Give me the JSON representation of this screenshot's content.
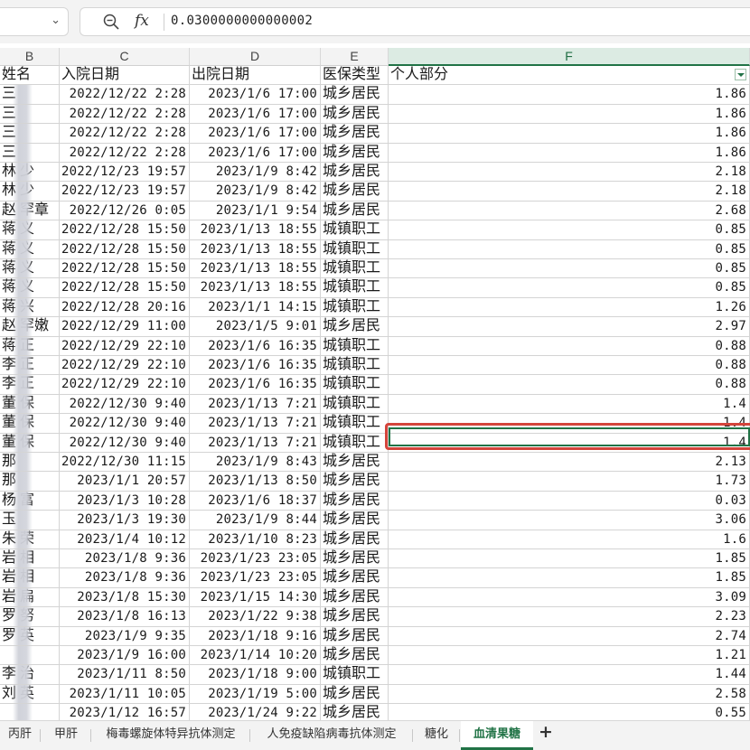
{
  "formula_bar": {
    "name_box_value": "",
    "formula_value": "0.0300000000000002"
  },
  "columns": [
    "B",
    "C",
    "D",
    "E",
    "F"
  ],
  "header_row": [
    "姓名",
    "入院日期",
    "出院日期",
    "医保类型",
    "个人部分"
  ],
  "rows": [
    [
      "三",
      "2022/12/22 2:28",
      "2023/1/6 17:00",
      "城乡居民",
      "1.86"
    ],
    [
      "三",
      "2022/12/22 2:28",
      "2023/1/6 17:00",
      "城乡居民",
      "1.86"
    ],
    [
      "三",
      "2022/12/22 2:28",
      "2023/1/6 17:00",
      "城乡居民",
      "1.86"
    ],
    [
      "三",
      "2022/12/22 2:28",
      "2023/1/6 17:00",
      "城乡居民",
      "1.86"
    ],
    [
      "林 少",
      "2022/12/23 19:57",
      "2023/1/9 8:42",
      "城乡居民",
      "2.18"
    ],
    [
      "林 少",
      "2022/12/23 19:57",
      "2023/1/9 8:42",
      "城乡居民",
      "2.18"
    ],
    [
      "赵 罕章",
      "2022/12/26 0:05",
      "2023/1/1 9:54",
      "城乡居民",
      "2.68"
    ],
    [
      "蒋 义",
      "2022/12/28 15:50",
      "2023/1/13 18:55",
      "城镇职工",
      "0.85"
    ],
    [
      "蒋 义",
      "2022/12/28 15:50",
      "2023/1/13 18:55",
      "城镇职工",
      "0.85"
    ],
    [
      "蒋 义",
      "2022/12/28 15:50",
      "2023/1/13 18:55",
      "城镇职工",
      "0.85"
    ],
    [
      "蒋 义",
      "2022/12/28 15:50",
      "2023/1/13 18:55",
      "城镇职工",
      "0.85"
    ],
    [
      "蒋 兴",
      "2022/12/28 20:16",
      "2023/1/1 14:15",
      "城镇职工",
      "1.26"
    ],
    [
      "赵 罕嫩",
      "2022/12/29 11:00",
      "2023/1/5 9:01",
      "城乡居民",
      "2.97"
    ],
    [
      "蒋 正",
      "2022/12/29 22:10",
      "2023/1/6 16:35",
      "城镇职工",
      "0.88"
    ],
    [
      "李 正",
      "2022/12/29 22:10",
      "2023/1/6 16:35",
      "城镇职工",
      "0.88"
    ],
    [
      "李 正",
      "2022/12/29 22:10",
      "2023/1/6 16:35",
      "城镇职工",
      "0.88"
    ],
    [
      "董 保",
      "2022/12/30 9:40",
      "2023/1/13 7:21",
      "城镇职工",
      "1.4"
    ],
    [
      "董 保",
      "2022/12/30 9:40",
      "2023/1/13 7:21",
      "城镇职工",
      "1.4"
    ],
    [
      "董 保",
      "2022/12/30 9:40",
      "2023/1/13 7:21",
      "城镇职工",
      "1.4"
    ],
    [
      "那",
      "2022/12/30 11:15",
      "2023/1/9 8:43",
      "城乡居民",
      "2.13"
    ],
    [
      "那",
      "2023/1/1 20:57",
      "2023/1/13 8:50",
      "城乡居民",
      "1.73"
    ],
    [
      "杨 富",
      "2023/1/3 10:28",
      "2023/1/6 18:37",
      "城乡居民",
      "0.03"
    ],
    [
      "玉",
      "2023/1/3 19:30",
      "2023/1/9 8:44",
      "城乡居民",
      "3.06"
    ],
    [
      "朱 荣",
      "2023/1/4 10:12",
      "2023/1/10 8:23",
      "城乡居民",
      "1.6"
    ],
    [
      "岩 相",
      "2023/1/8 9:36",
      "2023/1/23 23:05",
      "城乡居民",
      "1.85"
    ],
    [
      "岩 相",
      "2023/1/8 9:36",
      "2023/1/23 23:05",
      "城乡居民",
      "1.85"
    ],
    [
      "岩 扁",
      "2023/1/8 15:30",
      "2023/1/15 14:30",
      "城乡居民",
      "3.09"
    ],
    [
      "罗 努",
      "2023/1/8 16:13",
      "2023/1/22 9:38",
      "城乡居民",
      "2.23"
    ],
    [
      "罗 英",
      "2023/1/9 9:35",
      "2023/1/18 9:16",
      "城乡居民",
      "2.74"
    ],
    [
      "",
      "2023/1/9 16:00",
      "2023/1/14 10:20",
      "城乡居民",
      "1.21"
    ],
    [
      "李 治",
      "2023/1/11 8:50",
      "2023/1/18 9:00",
      "城镇职工",
      "1.44"
    ],
    [
      "刘 英",
      "2023/1/11 10:05",
      "2023/1/19 5:00",
      "城乡居民",
      "2.58"
    ],
    [
      "",
      "2023/1/12 16:57",
      "2023/1/24 9:22",
      "城乡居民",
      "0.55"
    ]
  ],
  "selected_row_index": 21,
  "sheet_tabs": [
    "丙肝",
    "甲肝",
    "梅毒螺旋体特异抗体测定",
    "人免疫缺陷病毒抗体测定",
    "糖化",
    "血清果糖"
  ],
  "active_tab": "血清果糖",
  "add_tab_label": "+",
  "colors": {
    "accent": "#217346",
    "annotation": "#d4453c"
  }
}
